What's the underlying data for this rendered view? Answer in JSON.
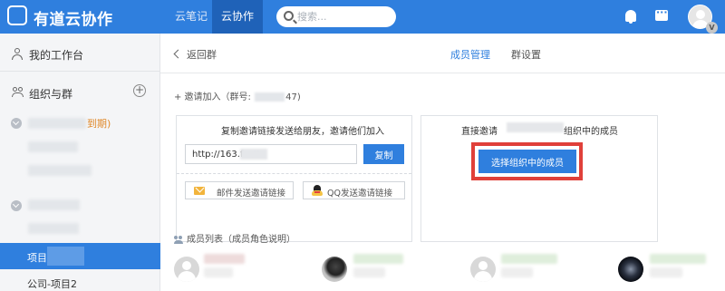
{
  "header": {
    "app_title": "有道云协作",
    "nav_tabs": [
      {
        "label": "云笔记",
        "active": false
      },
      {
        "label": "云协作",
        "active": true
      }
    ],
    "search": {
      "placeholder": "搜索..."
    },
    "icons": [
      "logo-icon",
      "bell-icon",
      "chat-icon",
      "avatar"
    ],
    "avatar_badge": "V",
    "colors": {
      "brand": "#2f7fde",
      "active_tab": "#1f62b8"
    }
  },
  "sidebar": {
    "workspace_label": "我的工作台",
    "groups_label": "组织与群",
    "expire_fragment": "到期)",
    "active_project_label": "项目-",
    "project2_label": "公司-项目2"
  },
  "main": {
    "back_label": "返回群",
    "tabs": [
      {
        "label": "成员管理",
        "active": true
      },
      {
        "label": "群设置",
        "active": false
      }
    ],
    "invite": {
      "prefix": "+ 邀请加入（群号: ",
      "suffix": "47)"
    },
    "left_card": {
      "title": "复制邀请链接发送给朋友，邀请他们加入",
      "link_value": "http://163.fm/1",
      "copy_button": "复制",
      "email_button": "邮件发送邀请链接",
      "qq_button": "QQ发送邀请链接"
    },
    "right_card": {
      "title_prefix": "直接邀请",
      "title_suffix": "组织中的成员",
      "select_button": "选择组织中的成员"
    },
    "members_label": "成员列表（成员角色说明）"
  }
}
